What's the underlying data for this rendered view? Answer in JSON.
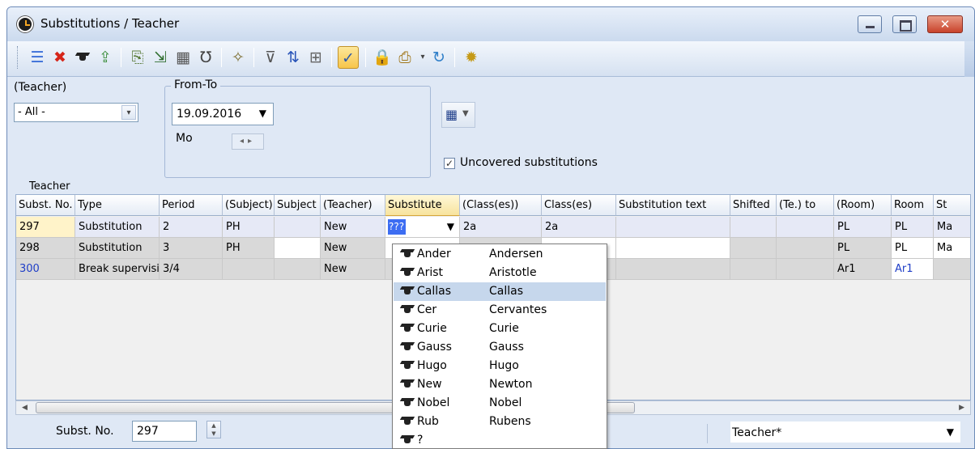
{
  "window": {
    "title": "Substitutions / Teacher",
    "close_glyph": "✕"
  },
  "toolbar": {
    "icons": [
      "list-icon",
      "delete-icon",
      "teacher-cap-icon",
      "export-icon",
      "copy-icon",
      "import-icon",
      "calculator-icon",
      "stethoscope-icon",
      "magic-wand-icon",
      "filter-icon",
      "sort-icon",
      "grid-icon",
      "edit-check-icon",
      "lock-icon",
      "print-icon",
      "refresh-icon",
      "settings-icon"
    ]
  },
  "filters": {
    "teacher_label": "(Teacher)",
    "teacher_value": "- All -",
    "fromto_label": "From-To",
    "date_value": "19.09.2016",
    "day_label": "Mo",
    "uncovered_label": "Uncovered substitutions",
    "uncovered_checked": true,
    "section_label": "Teacher"
  },
  "grid": {
    "columns": [
      "Subst. No.",
      "Type",
      "Period",
      "(Subject)",
      "Subject",
      "(Teacher)",
      "Substitute",
      "(Class(es))",
      "Class(es)",
      "Substitution text",
      "Shifted",
      "(Te.) to",
      "(Room)",
      "Room",
      "St"
    ],
    "rows": [
      {
        "no": "297",
        "type": "Substitution",
        "period": "2",
        "subject_orig": "PH",
        "subject": "",
        "teacher": "New",
        "substitute": "???",
        "classes_orig": "2a",
        "classes": "2a",
        "text": "",
        "shifted": "",
        "te_to": "",
        "room_orig": "PL",
        "room": "PL",
        "st": "Ma"
      },
      {
        "no": "298",
        "type": "Substitution",
        "period": "3",
        "subject_orig": "PH",
        "subject": "",
        "teacher": "New",
        "substitute": "",
        "classes_orig": "",
        "classes": "",
        "text": "",
        "shifted": "",
        "te_to": "",
        "room_orig": "PL",
        "room": "PL",
        "st": "Ma"
      },
      {
        "no": "300",
        "type": "Break supervision",
        "period": "3/4",
        "subject_orig": "",
        "subject": "",
        "teacher": "New",
        "substitute": "",
        "classes_orig": "",
        "classes": "",
        "text": "",
        "shifted": "",
        "te_to": "",
        "room_orig": "Ar1",
        "room": "Ar1",
        "st": ""
      }
    ]
  },
  "dropdown": {
    "items": [
      {
        "short": "Ander",
        "long": "Andersen"
      },
      {
        "short": "Arist",
        "long": "Aristotle"
      },
      {
        "short": "Callas",
        "long": "Callas",
        "selected": true
      },
      {
        "short": "Cer",
        "long": "Cervantes"
      },
      {
        "short": "Curie",
        "long": "Curie"
      },
      {
        "short": "Gauss",
        "long": "Gauss"
      },
      {
        "short": "Hugo",
        "long": "Hugo"
      },
      {
        "short": "New",
        "long": "Newton"
      },
      {
        "short": "Nobel",
        "long": "Nobel"
      },
      {
        "short": "Rub",
        "long": "Rubens"
      },
      {
        "short": "?",
        "long": ""
      }
    ]
  },
  "status": {
    "subst_no_label": "Subst. No.",
    "subst_no_value": "297",
    "view_value": "Teacher*"
  },
  "colors": {
    "accent": "#3d6df2",
    "highlight": "#f7e39d",
    "panel": "#dfe8f5"
  }
}
